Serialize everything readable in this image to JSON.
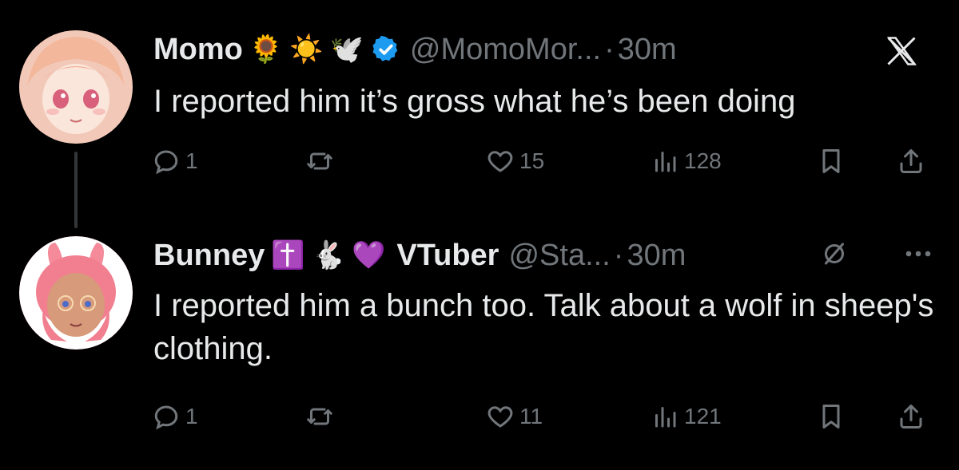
{
  "tweets": [
    {
      "name": "Momo",
      "emojis": [
        "🌻",
        "☀️",
        "🕊️"
      ],
      "handle": "@MomoMor...",
      "separator": "·",
      "time": "30m",
      "text": "I reported him it’s gross what he’s been doing",
      "reply_count": "1",
      "like_count": "15",
      "view_count": "128"
    },
    {
      "name": "Bunney",
      "emojis": [
        "✝️",
        "🐇",
        "💜"
      ],
      "tag": "VTuber",
      "handle": "@Sta...",
      "separator": "·",
      "time": "30m",
      "text": "I reported him a bunch too. Talk about a wolf in sheep's clothing.",
      "reply_count": "1",
      "like_count": "11",
      "view_count": "121"
    }
  ],
  "icons": {
    "verified": "verified-badge-icon",
    "corner_top": "x-logo-icon",
    "corner_mute": "mute-icon",
    "corner_more": "more-icon",
    "actions": [
      "reply-icon",
      "retweet-icon",
      "like-icon",
      "views-icon",
      "bookmark-icon",
      "share-icon"
    ]
  },
  "colors": {
    "background": "#000000",
    "text": "#e7e9ea",
    "muted": "#71767b",
    "verified": "#1d9bf0",
    "thread_line": "#333639"
  }
}
